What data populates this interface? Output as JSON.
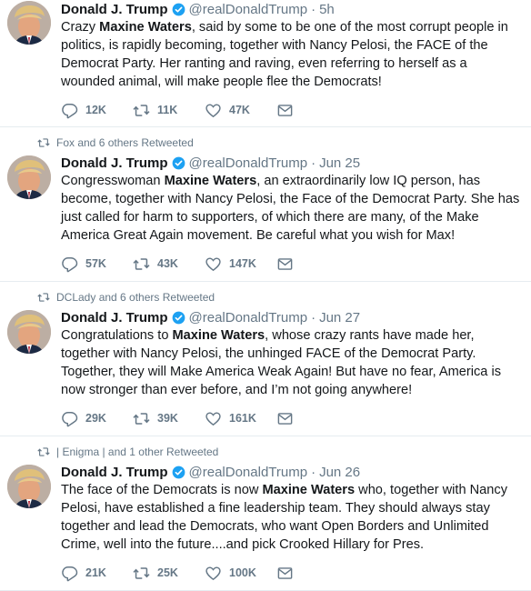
{
  "tweets": [
    {
      "retweet_by": "",
      "name": "Donald J. Trump",
      "handle": "@realDonaldTrump",
      "time": "5h",
      "text_before": "Crazy ",
      "highlight": "Maxine Waters",
      "text_after": ", said by some to be one of the most corrupt people in politics, is rapidly becoming, together with Nancy Pelosi, the FACE of the Democrat Party. Her ranting and raving, even referring to herself as a wounded animal, will make people flee the Democrats!",
      "replies": "12K",
      "retweets": "11K",
      "likes": "47K"
    },
    {
      "retweet_by": "Fox and 6 others Retweeted",
      "name": "Donald J. Trump",
      "handle": "@realDonaldTrump",
      "time": "Jun 25",
      "text_before": "Congresswoman ",
      "highlight": "Maxine Waters",
      "text_after": ", an extraordinarily low IQ person, has become, together with Nancy Pelosi, the Face of the Democrat Party. She has just called for harm to supporters, of which there are many, of the Make America Great Again movement. Be careful what you wish for Max!",
      "replies": "57K",
      "retweets": "43K",
      "likes": "147K"
    },
    {
      "retweet_by": "DCLady and 6 others Retweeted",
      "name": "Donald J. Trump",
      "handle": "@realDonaldTrump",
      "time": "Jun 27",
      "text_before": "Congratulations to ",
      "highlight": "Maxine Waters",
      "text_after": ", whose crazy rants have made her, together with Nancy Pelosi, the unhinged FACE of the Democrat Party. Together, they will Make America Weak Again! But have no fear, America is now stronger than ever before, and I’m not going anywhere!",
      "replies": "29K",
      "retweets": "39K",
      "likes": "161K"
    },
    {
      "retweet_by": "| Enigma | and 1 other Retweeted",
      "name": "Donald J. Trump",
      "handle": "@realDonaldTrump",
      "time": "Jun 26",
      "text_before": "The face of the Democrats is now ",
      "highlight": "Maxine Waters",
      "text_after": " who, together with Nancy Pelosi, have established a fine leadership team. They should always stay together and lead the Democrats, who want Open Borders and Unlimited Crime, well into the future....and pick Crooked Hillary for Pres.",
      "replies": "21K",
      "retweets": "25K",
      "likes": "100K"
    }
  ],
  "colors": {
    "text": "#14171a",
    "muted": "#657786",
    "verified": "#1da1f2",
    "divider": "#e6ecf0"
  },
  "icons": [
    "reply-icon",
    "retweet-icon",
    "like-icon",
    "dm-icon",
    "verified-icon"
  ]
}
